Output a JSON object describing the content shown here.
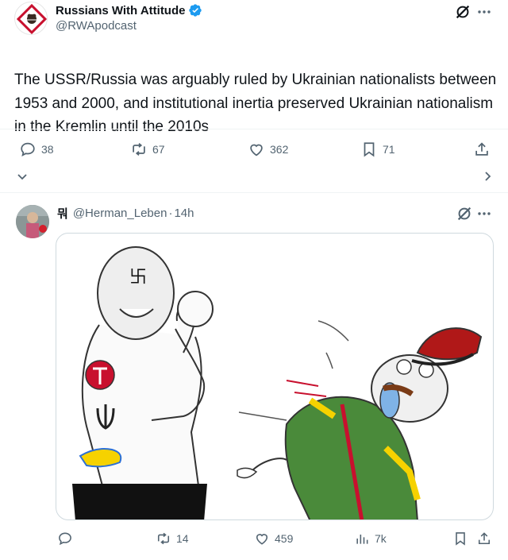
{
  "post": {
    "author_name": "Russians With Attitude",
    "author_handle": "@RWApodcast",
    "text": "The USSR/Russia was arguably ruled by Ukrainian nationalists between 1953 and 2000, and institutional inertia preserved Ukrainian nationalism in the Kremlin until the 2010s",
    "actions": {
      "replies": "38",
      "reposts": "67",
      "likes": "362",
      "bookmarks": "71"
    }
  },
  "reply": {
    "author_mark": "뭐",
    "author_handle": "@Herman_Leben",
    "separator": "·",
    "time": "14h",
    "actions": {
      "replies": "",
      "reposts": "14",
      "likes": "459",
      "views": "7k"
    }
  },
  "colors": {
    "accent": "#1d9bf0",
    "text": "#0f1419",
    "muted": "#536471",
    "divider": "#eff3f4",
    "verified": "#1d9bf0"
  }
}
